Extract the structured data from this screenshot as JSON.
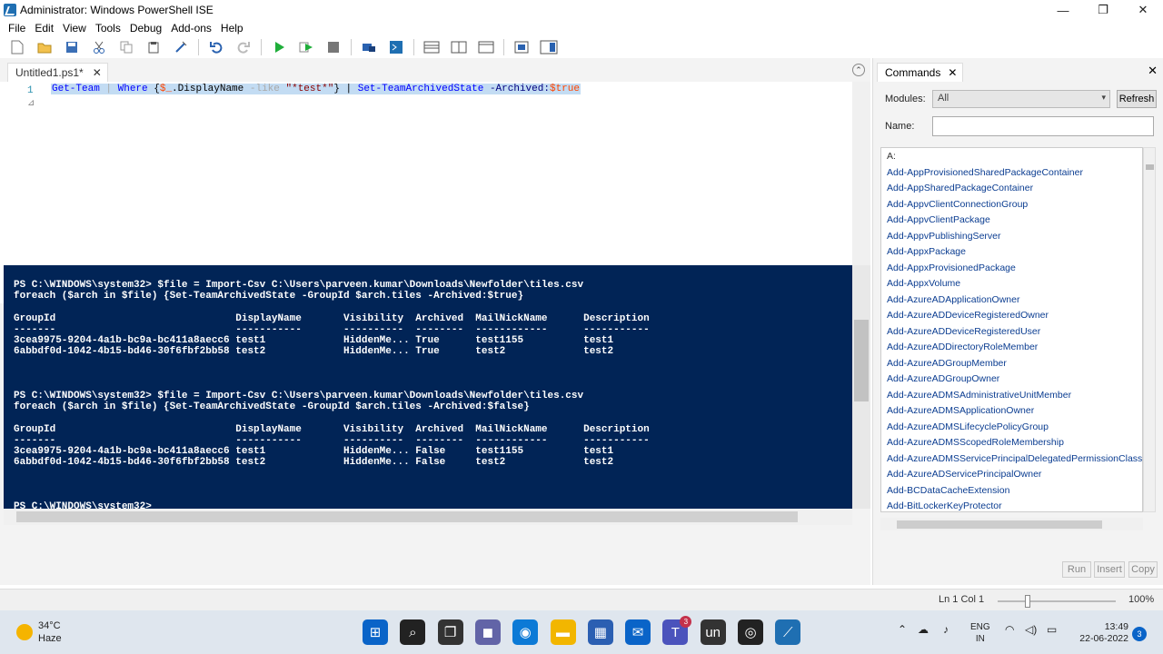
{
  "window": {
    "title": "Administrator: Windows PowerShell ISE",
    "minimize": "—",
    "maximize": "❐",
    "close": "✕"
  },
  "menu": [
    "File",
    "Edit",
    "View",
    "Tools",
    "Debug",
    "Add-ons",
    "Help"
  ],
  "editor": {
    "tab_label": "Untitled1.ps1*",
    "tab_close": "✕",
    "collapse": "⌃",
    "line_number": "1",
    "fold_marker": "⊿",
    "code": {
      "t1": "Get-Team",
      "t2": " | ",
      "t3": "Where",
      "t4": " {",
      "t5": "$_",
      "t6": ".DisplayName ",
      "t7": "-like",
      "t8": " ",
      "t9": "\"*test*\"",
      "t10": "} | ",
      "t11": "Set-TeamArchivedState",
      "t12": " ",
      "t13": "-Archived:",
      "t14": "$true"
    }
  },
  "console": {
    "lines": [
      "PS C:\\WINDOWS\\system32> $file = Import-Csv C:\\Users\\parveen.kumar\\Downloads\\Newfolder\\tiles.csv",
      "foreach ($arch in $file) {Set-TeamArchivedState -GroupId $arch.tiles -Archived:$true}",
      "",
      "GroupId                              DisplayName       Visibility  Archived  MailNickName      Description",
      "-------                              -----------       ----------  --------  ------------      -----------",
      "3cea9975-9204-4a1b-bc9a-bc411a8aecc6 test1             HiddenMe... True      test1155          test1",
      "6abbdf0d-1042-4b15-bd46-30f6fbf2bb58 test2             HiddenMe... True      test2             test2",
      "",
      "",
      "",
      "PS C:\\WINDOWS\\system32> $file = Import-Csv C:\\Users\\parveen.kumar\\Downloads\\Newfolder\\tiles.csv",
      "foreach ($arch in $file) {Set-TeamArchivedState -GroupId $arch.tiles -Archived:$false}",
      "",
      "GroupId                              DisplayName       Visibility  Archived  MailNickName      Description",
      "-------                              -----------       ----------  --------  ------------      -----------",
      "3cea9975-9204-4a1b-bc9a-bc411a8aecc6 test1             HiddenMe... False     test1155          test1",
      "6abbdf0d-1042-4b15-bd46-30f6fbf2bb58 test2             HiddenMe... False     test2             test2",
      "",
      "",
      "",
      "PS C:\\WINDOWS\\system32>"
    ]
  },
  "commands": {
    "tab_label": "Commands",
    "tab_close": "✕",
    "pane_close": "✕",
    "modules_label": "Modules:",
    "modules_value": "All",
    "select_arrow": "▾",
    "refresh": "Refresh",
    "name_label": "Name:",
    "name_value": "",
    "items": [
      "A:",
      "Add-AppProvisionedSharedPackageContainer",
      "Add-AppSharedPackageContainer",
      "Add-AppvClientConnectionGroup",
      "Add-AppvClientPackage",
      "Add-AppvPublishingServer",
      "Add-AppxPackage",
      "Add-AppxProvisionedPackage",
      "Add-AppxVolume",
      "Add-AzureADApplicationOwner",
      "Add-AzureADDeviceRegisteredOwner",
      "Add-AzureADDeviceRegisteredUser",
      "Add-AzureADDirectoryRoleMember",
      "Add-AzureADGroupMember",
      "Add-AzureADGroupOwner",
      "Add-AzureADMSAdministrativeUnitMember",
      "Add-AzureADMSApplicationOwner",
      "Add-AzureADMSLifecyclePolicyGroup",
      "Add-AzureADMSScopedRoleMembership",
      "Add-AzureADMSServicePrincipalDelegatedPermissionClassifi",
      "Add-AzureADServicePrincipalOwner",
      "Add-BCDataCacheExtension",
      "Add-BitLockerKeyProtector"
    ],
    "run": "Run",
    "insert": "Insert",
    "copy": "Copy"
  },
  "status": {
    "position": "Ln 1  Col 1",
    "zoom": "100%",
    "zoom_level": 0.25
  },
  "taskbar": {
    "temp": "34°C",
    "condition": "Haze",
    "lang1": "ENG",
    "lang2": "IN",
    "time": "13:49",
    "date": "22-06-2022",
    "teams_badge": "3",
    "notifications": "3",
    "pinned": [
      {
        "name": "windows-start-icon",
        "glyph": "⊞",
        "color": "#0a64c8"
      },
      {
        "name": "search-icon",
        "glyph": "⌕",
        "color": "#222222"
      },
      {
        "name": "task-view-icon",
        "glyph": "❐",
        "color": "#333333"
      },
      {
        "name": "chat-icon",
        "glyph": "◼",
        "color": "#6264a7"
      },
      {
        "name": "edge-icon",
        "glyph": "◉",
        "color": "#0c7ad6"
      },
      {
        "name": "file-explorer-icon",
        "glyph": "▬",
        "color": "#f2b600"
      },
      {
        "name": "store-icon",
        "glyph": "▦",
        "color": "#2b5fb2"
      },
      {
        "name": "mail-icon",
        "glyph": "✉",
        "color": "#0a64c8"
      },
      {
        "name": "teams-icon",
        "glyph": "T",
        "color": "#4b53bc"
      },
      {
        "name": "un-app-icon",
        "glyph": "un",
        "color": "#333333"
      },
      {
        "name": "obs-icon",
        "glyph": "◎",
        "color": "#222222"
      },
      {
        "name": "powershell-ise-icon",
        "glyph": "⟋",
        "color": "#1f6fb2"
      }
    ]
  },
  "colors": {
    "console_bg": "#012456",
    "selection": "#c3dcf3"
  }
}
